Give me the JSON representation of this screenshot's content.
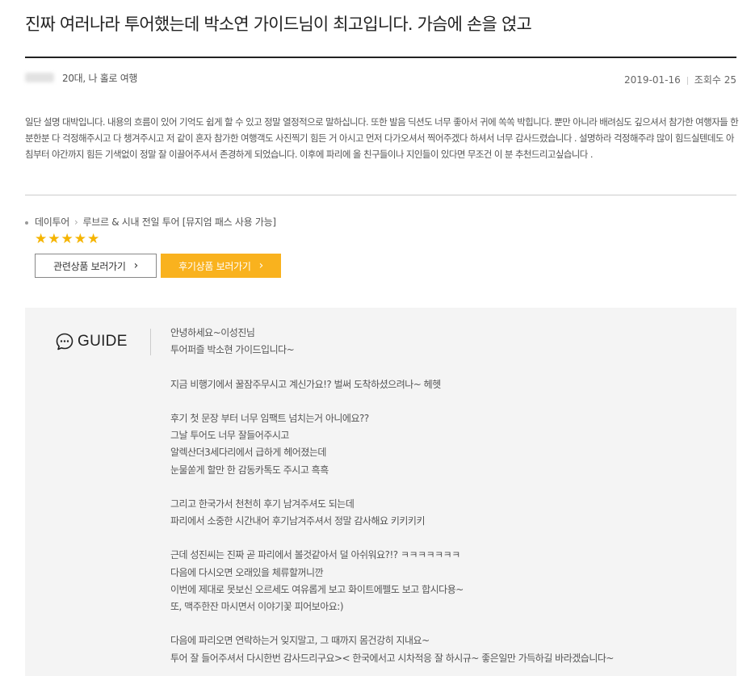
{
  "review": {
    "title": "진짜 여러나라 투어했는데 박소연 가이드님이 최고입니다. 가슴에 손을 얹고",
    "meta_info": "20대, 나 홀로 여행",
    "date": "2019-01-16",
    "views": "조회수 25",
    "body": "일단 설명 대박입니다. 내용의 흐름이 있어 기억도 쉽게 할 수 있고 정말 열정적으로 말하십니다. 또한 발음 딕션도 너무 좋아서 귀에 쏙쏙 박힙니다. 뿐만 아니라 배려심도 깊으셔서 참가한 여행자들 한분한분 다 걱정해주시고 다 챙겨주시고 저 같이 혼자 참가한 여행객도 사진찍기 힘든 거 아시고 먼저 다가오셔서 찍어주겠다 하셔서 너무 감사드렸습니다 . 설명하라 걱정해주랴 많이 힘드실텐데도 아침부터 야간까지 힘든 기색없이 정말 잘 이끌어주셔서 존경하게 되었습니다. 이후에 파리에 올 친구들이나 지인들이 있다면 무조건 이 분 추천드리고싶습니다 ."
  },
  "product": {
    "category": "데이투어",
    "name": "루브르 & 시내 전일 투어 [뮤지엄 패스 사용 가능]",
    "rating": 5,
    "stars_text": "★★★★★",
    "star_color": "#f5b400"
  },
  "buttons": {
    "related": "관련상품 보러가기",
    "review": "후기상품 보러가기",
    "accent_color": "#f9b21e"
  },
  "guide": {
    "label": "GUIDE",
    "lines": [
      "안녕하세요~이성진님",
      "투어퍼즐 박소현 가이드입니다~",
      "",
      "지금 비행기에서 꿀잠주무시고 계신가요!? 벌써 도착하셨으려나~ 헤헷",
      "",
      "후기 첫 문장 부터 너무 임팩트 넘치는거 아니에요??",
      "그날 투어도 너무 잘들어주시고",
      "알렉산더3세다리에서 급하게 헤어졌는데",
      "눈물쏟게 할만 한 감동카톡도 주시고 흑흑",
      "",
      "그리고 한국가서 천천히 후기 남겨주셔도 되는데",
      "파리에서 소중한 시간내어 후기남겨주셔서 정말 감사해요 키키키키",
      "",
      "근데 성진씨는 진짜 곧 파리에서 볼것같아서 덜 아쉬워요?!? ㅋㅋㅋㅋㅋㅋㅋ",
      "다음에 다시오면 오래있을 체류할꺼니깐",
      "이번에 제대로 못보신 오르세도 여유롭게 보고 화이트에펠도 보고 합시다용~",
      "또, 맥주한잔 마시면서 이야기꽃 피어보아요:)",
      "",
      "다음에 파리오면 연락하는거 잊지말고, 그 때까지 몸건강히 지내요~",
      "투어 잘 들어주셔서 다시한번 감사드리구요>< 한국에서고 시차적응 잘 하시규~ 좋은일만 가득하길 바라겠습니다~"
    ]
  }
}
